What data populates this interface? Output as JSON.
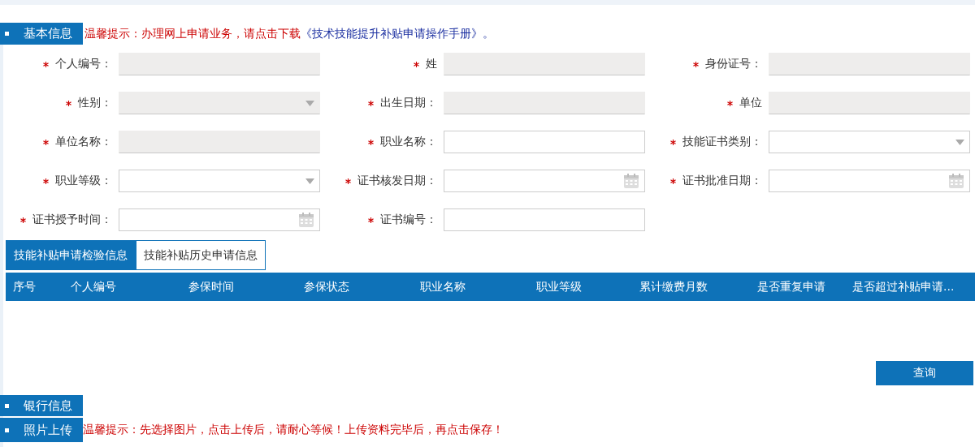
{
  "basic_info": {
    "title": "基本信息",
    "notice_text": "温馨提示：办理网上申请业务，请点击下载",
    "notice_link": "《技术技能提升补贴申请操作手册》。",
    "fields": [
      {
        "label": "个人编号：",
        "required": true,
        "kind": "text",
        "readonly": true
      },
      {
        "label": "姓",
        "required": true,
        "kind": "text",
        "readonly": true
      },
      {
        "label": "身份证号：",
        "required": true,
        "kind": "text",
        "readonly": true
      },
      {
        "label": "性别：",
        "required": true,
        "kind": "select",
        "readonly": true
      },
      {
        "label": "出生日期：",
        "required": true,
        "kind": "text",
        "readonly": true
      },
      {
        "label": "单位",
        "required": true,
        "kind": "text",
        "readonly": true
      },
      {
        "label": "单位名称：",
        "required": true,
        "kind": "text",
        "readonly": true
      },
      {
        "label": "职业名称：",
        "required": true,
        "kind": "text",
        "readonly": false
      },
      {
        "label": "技能证书类别：",
        "required": true,
        "kind": "select",
        "readonly": false
      },
      {
        "label": "职业等级：",
        "required": true,
        "kind": "select",
        "readonly": false
      },
      {
        "label": "证书核发日期：",
        "required": true,
        "kind": "date",
        "readonly": false
      },
      {
        "label": "证书批准日期：",
        "required": true,
        "kind": "date",
        "readonly": false
      },
      {
        "label": "证书授予时间：",
        "required": true,
        "kind": "date",
        "readonly": false
      },
      {
        "label": "证书编号：",
        "required": true,
        "kind": "text",
        "readonly": false
      }
    ]
  },
  "tabs": [
    {
      "label": "技能补贴申请检验信息",
      "selected": true
    },
    {
      "label": "技能补贴历史申请信息",
      "selected": false
    }
  ],
  "table": {
    "columns": [
      "序号",
      "个人编号",
      "参保时间",
      "参保状态",
      "职业名称",
      "职业等级",
      "累计缴费月数",
      "是否重复申请",
      "是否超过补贴申请..."
    ]
  },
  "query_button": "查询",
  "bank_info": {
    "title": "银行信息"
  },
  "photo_upload": {
    "title": "照片上传",
    "notice": "温馨提示：先选择图片，点击上传后，请耐心等候！上传资料完毕后，再点击保存！"
  }
}
